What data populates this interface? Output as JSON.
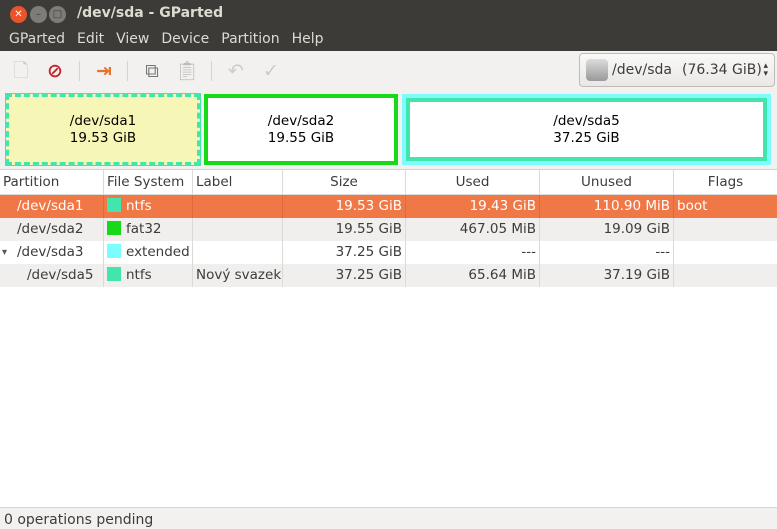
{
  "window": {
    "title": "/dev/sda - GParted"
  },
  "menu": [
    "GParted",
    "Edit",
    "View",
    "Device",
    "Partition",
    "Help"
  ],
  "device": {
    "name": "/dev/sda",
    "size": "(76.34 GiB)"
  },
  "map": [
    {
      "name": "/dev/sda1",
      "size": "19.53 GiB"
    },
    {
      "name": "/dev/sda2",
      "size": "19.55 GiB"
    },
    {
      "name": "/dev/sda5",
      "size": "37.25 GiB"
    }
  ],
  "columns": [
    "Partition",
    "File System",
    "Label",
    "Size",
    "Used",
    "Unused",
    "Flags"
  ],
  "rows": [
    {
      "partition": "/dev/sda1",
      "fs": "ntfs",
      "color": "#42e5ac",
      "label": "",
      "size": "19.53 GiB",
      "used": "19.43 GiB",
      "unused": "110.90 MiB",
      "flags": "boot"
    },
    {
      "partition": "/dev/sda2",
      "fs": "fat32",
      "color": "#18d918",
      "label": "",
      "size": "19.55 GiB",
      "used": "467.05 MiB",
      "unused": "19.09 GiB",
      "flags": ""
    },
    {
      "partition": "/dev/sda3",
      "fs": "extended",
      "color": "#7dfcfe",
      "label": "",
      "size": "37.25 GiB",
      "used": "---",
      "unused": "---",
      "flags": ""
    },
    {
      "partition": "/dev/sda5",
      "fs": "ntfs",
      "color": "#42e5ac",
      "label": "Nový svazek",
      "size": "37.25 GiB",
      "used": "65.64 MiB",
      "unused": "37.19 GiB",
      "flags": ""
    }
  ],
  "status": "0 operations pending"
}
